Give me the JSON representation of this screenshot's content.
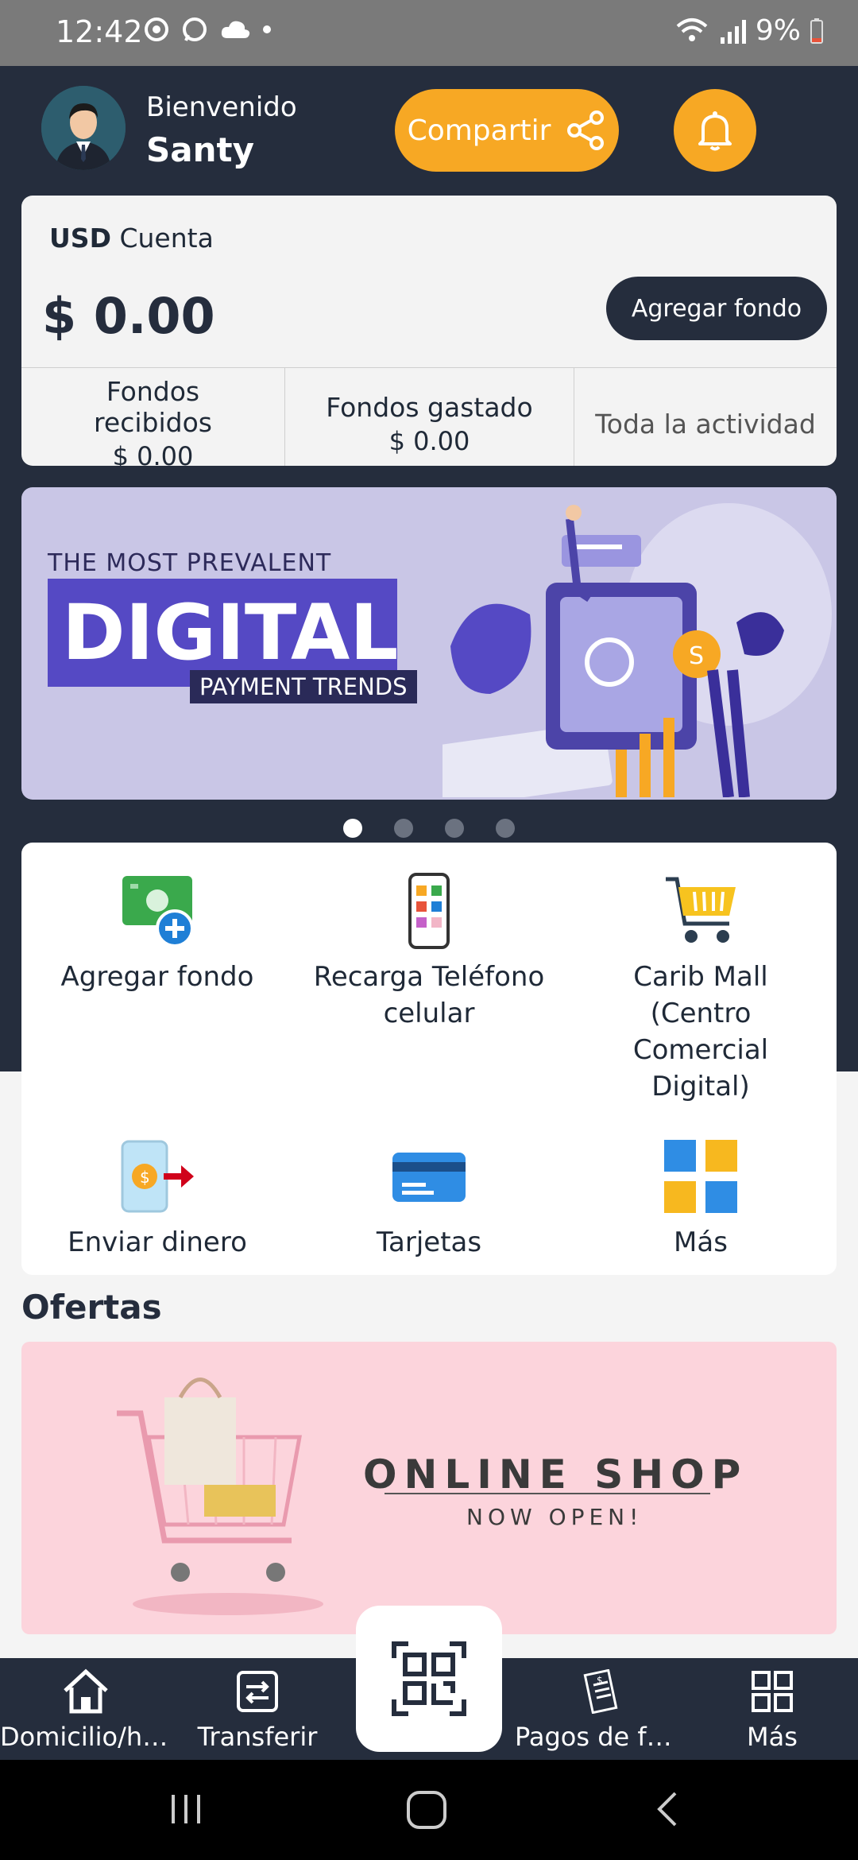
{
  "status_bar": {
    "time": "12:42",
    "battery": "9%"
  },
  "header": {
    "welcome": "Bienvenido",
    "user_name": "Santy",
    "share_label": "Compartir"
  },
  "account": {
    "currency": "USD",
    "label": "Cuenta",
    "balance": "$ 0.00",
    "add_fund_label": "Agregar fondo",
    "stats": [
      {
        "label": "Fondos recibidos",
        "value": "$ 0.00"
      },
      {
        "label": "Fondos gastado",
        "value": "$ 0.00"
      },
      {
        "label": "Toda la actividad"
      }
    ]
  },
  "promo_banner": {
    "line1": "THE MOST PREVALENT",
    "line2": "DIGITAL",
    "line3": "PAYMENT TRENDS",
    "slides": 4,
    "active_slide": 1
  },
  "services": [
    {
      "label": "Agregar fondo",
      "icon": "add-fund-icon"
    },
    {
      "label": "Recarga Teléfono celular",
      "icon": "phone-recharge-icon"
    },
    {
      "label": "Carib Mall (Centro Comercial Digital)",
      "icon": "shopping-cart-icon"
    },
    {
      "label": "Enviar dinero",
      "icon": "send-money-icon"
    },
    {
      "label": "Tarjetas",
      "icon": "card-icon"
    },
    {
      "label": "Más",
      "icon": "grid-icon"
    }
  ],
  "offers": {
    "title": "Ofertas",
    "banner_line1": "ONLINE SHOP",
    "banner_line2": "NOW OPEN!"
  },
  "bottom_nav": [
    {
      "label": "Domicilio/ho…",
      "icon": "home-icon"
    },
    {
      "label": "Transferir",
      "icon": "transfer-icon"
    },
    {
      "label": "",
      "icon": "qr-code-icon"
    },
    {
      "label": "Pagos de fá…",
      "icon": "bill-icon"
    },
    {
      "label": "Más",
      "icon": "grid-icon"
    }
  ],
  "colors": {
    "dark": "#252d3d",
    "accent": "#f7a824",
    "banner_purple": "#5549c4",
    "offer_pink": "#fcd4dc"
  }
}
